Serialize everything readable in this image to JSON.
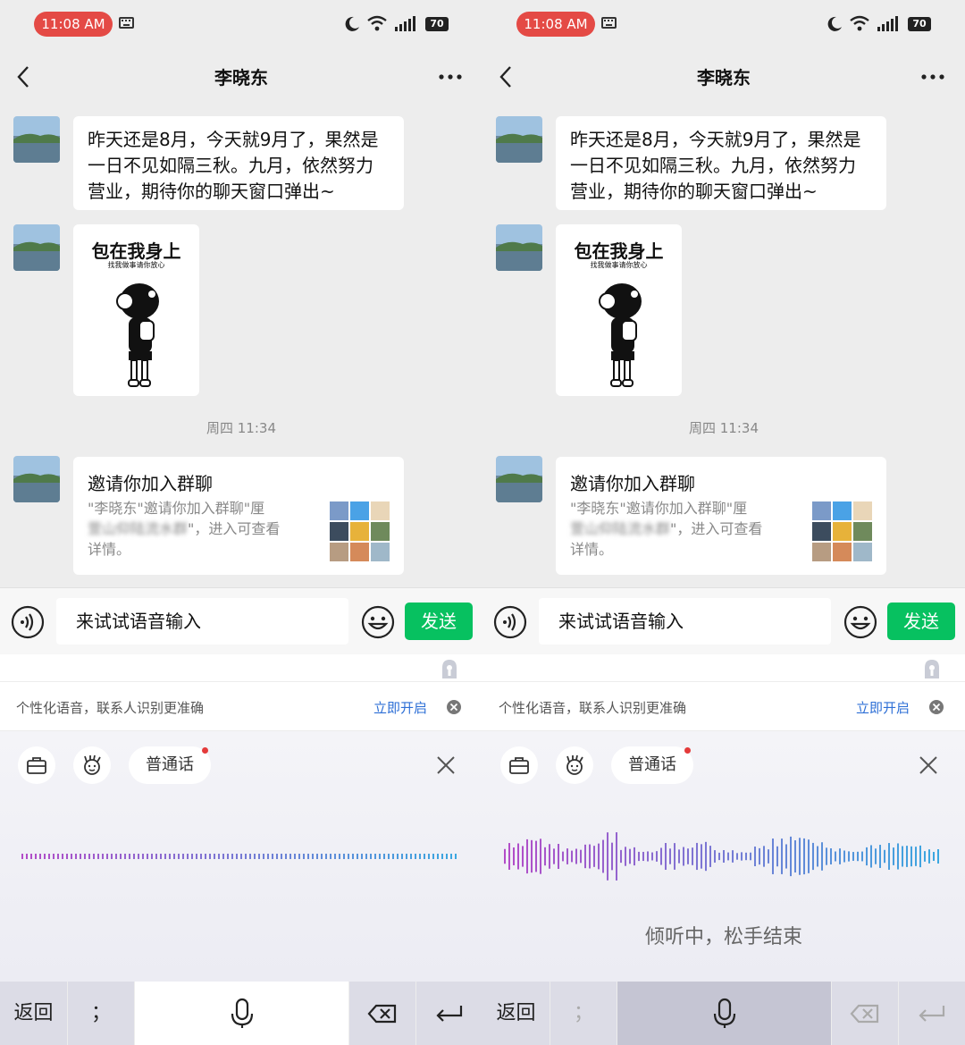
{
  "status": {
    "time": "11:08 AM",
    "battery": "70"
  },
  "chat": {
    "title": "李晓东"
  },
  "messages": {
    "text": "昨天还是8月，今天就9月了，果然是一日不见如隔三秋。九月，依然努力营业，期待你的聊天窗口弹出~",
    "sticker_title": "包在我身上",
    "sticker_subtitle": "找我做事请你放心",
    "timestamp": "周四 11:34",
    "invite_title": "邀请你加入群聊",
    "invite_desc_line1": "\"李晓东\"邀请你加入群聊\"厘",
    "invite_desc_blurred": "萱山仰陆流水群",
    "invite_desc_line2": "\"，进入可查看",
    "invite_desc_line3": "详情。"
  },
  "input": {
    "value": "来试试语音输入",
    "send_label": "发送"
  },
  "notice": {
    "text": "个性化语音，联系人识别更准确",
    "action": "立即开启"
  },
  "voice": {
    "language": "普通话",
    "listening_text": "倾听中，松手结束"
  },
  "keyboard": {
    "back_label": "返回",
    "punct_label": "；"
  },
  "colors": {
    "send_green": "#07c160",
    "link_blue": "#2d6fd6",
    "time_red": "#e44a45",
    "wave_start": "#b34cc8",
    "wave_end": "#3aa8e0"
  }
}
